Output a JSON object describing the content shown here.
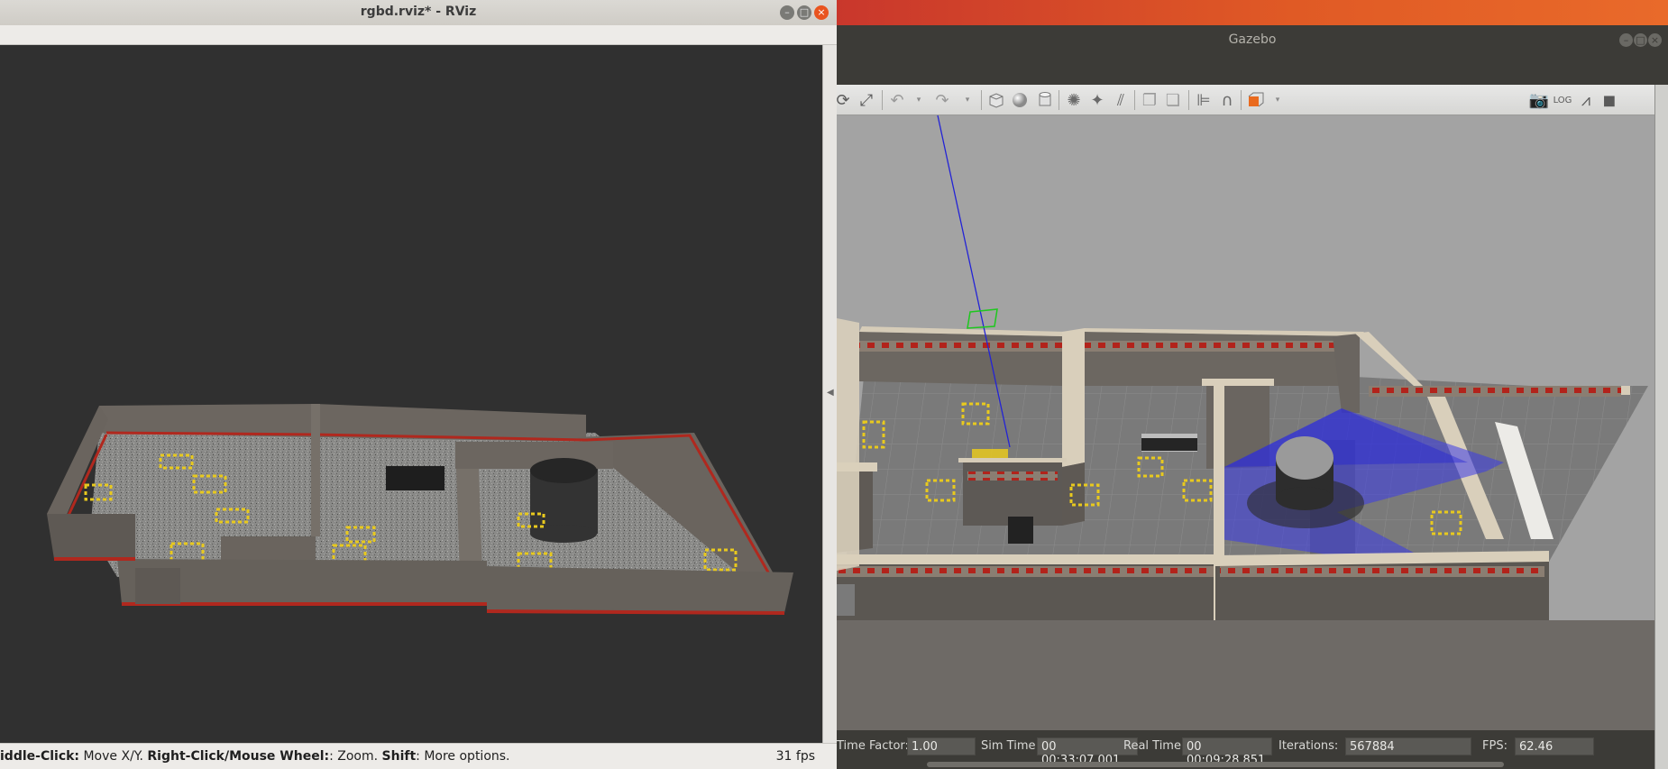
{
  "rviz": {
    "title": "rgbd.rviz* - RViz",
    "status": {
      "h1": "iddle-Click:",
      "t1": " Move X/Y. ",
      "h2": "Right-Click/Mouse Wheel:",
      "t2": ": Zoom. ",
      "h3": "Shift",
      "t3": ": More options."
    },
    "fps": "31 fps"
  },
  "gazebo": {
    "title": "Gazebo",
    "status": {
      "time_factor_label": "Time Factor:",
      "time_factor_value": "1.00",
      "sim_time_label": "Sim Time:",
      "sim_time_value": "00 00:33:07.001",
      "real_time_label": "Real Time:",
      "real_time_value": "00 00:09:28.851",
      "iterations_label": "Iterations:",
      "iterations_value": "567884",
      "fps_label": "FPS:",
      "fps_value": "62.46"
    }
  },
  "colors": {
    "ubuntu_orange": "#e05a25",
    "rviz_bg": "#303030",
    "gazebo_sky": "#a3a3a3",
    "hazard_yellow": "#e8c91e",
    "wall_red": "#b2231b",
    "laser_blue": "#2f2fe8"
  }
}
